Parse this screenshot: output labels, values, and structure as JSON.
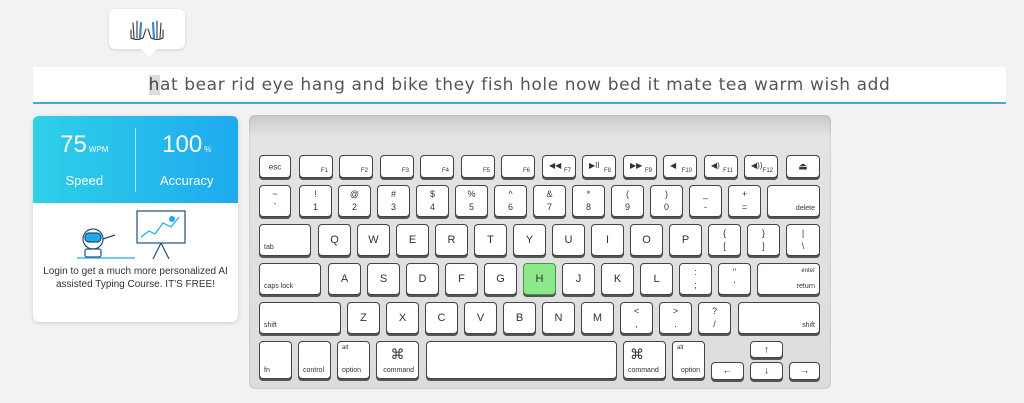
{
  "hands_icon": "hands-icon",
  "typing_text": {
    "current_char": "h",
    "remaining": "at bear rid eye hang and bike they fish hole now bed it mate tea warm wish add"
  },
  "stats": {
    "speed_value": "75",
    "speed_unit": "WPM",
    "speed_label": "Speed",
    "accuracy_value": "100",
    "accuracy_unit": "%",
    "accuracy_label": "Accuracy"
  },
  "promo": {
    "illustration_icon": "robot-presentation-icon",
    "text": "Login to get a much more personalized AI assisted Typing Course. IT'S FREE!"
  },
  "keyboard": {
    "highlighted_key": "H",
    "row_fn": [
      {
        "main": "esc"
      },
      {
        "fn": "F1"
      },
      {
        "fn": "F2"
      },
      {
        "fn": "F3"
      },
      {
        "fn": "F4"
      },
      {
        "fn": "F5"
      },
      {
        "fn": "F6"
      },
      {
        "sym": "◀◀",
        "fn": "F7"
      },
      {
        "sym": "▶II",
        "fn": "F8"
      },
      {
        "sym": "▶▶",
        "fn": "F9"
      },
      {
        "sym": "◀",
        "fn": "F10"
      },
      {
        "sym": "◀)",
        "fn": "F11"
      },
      {
        "sym": "◀))",
        "fn": "F12"
      },
      {
        "main": "⏏"
      }
    ],
    "row_num": [
      {
        "top": "~",
        "bot": "`"
      },
      {
        "top": "!",
        "bot": "1"
      },
      {
        "top": "@",
        "bot": "2"
      },
      {
        "top": "#",
        "bot": "3"
      },
      {
        "top": "$",
        "bot": "4"
      },
      {
        "top": "%",
        "bot": "5"
      },
      {
        "top": "^",
        "bot": "6"
      },
      {
        "top": "&",
        "bot": "7"
      },
      {
        "top": "*",
        "bot": "8"
      },
      {
        "top": "(",
        "bot": "9"
      },
      {
        "top": ")",
        "bot": "0"
      },
      {
        "top": "_",
        "bot": "-"
      },
      {
        "top": "+",
        "bot": "="
      },
      {
        "label": "delete"
      }
    ],
    "row_q": [
      {
        "label": "tab"
      },
      {
        "main": "Q"
      },
      {
        "main": "W"
      },
      {
        "main": "E"
      },
      {
        "main": "R"
      },
      {
        "main": "T"
      },
      {
        "main": "Y"
      },
      {
        "main": "U"
      },
      {
        "main": "I"
      },
      {
        "main": "O"
      },
      {
        "main": "P"
      },
      {
        "top": "{",
        "bot": "["
      },
      {
        "top": "}",
        "bot": "]"
      },
      {
        "top": "|",
        "bot": "\\"
      }
    ],
    "row_a": [
      {
        "label": "caps lock"
      },
      {
        "main": "A"
      },
      {
        "main": "S"
      },
      {
        "main": "D"
      },
      {
        "main": "F"
      },
      {
        "main": "G"
      },
      {
        "main": "H"
      },
      {
        "main": "J"
      },
      {
        "main": "K"
      },
      {
        "main": "L"
      },
      {
        "top": ":",
        "bot": ";"
      },
      {
        "top": "\"",
        "bot": "'"
      },
      {
        "top_right": "enter",
        "label": "return"
      }
    ],
    "row_z": [
      {
        "label": "shift"
      },
      {
        "main": "Z"
      },
      {
        "main": "X"
      },
      {
        "main": "C"
      },
      {
        "main": "V"
      },
      {
        "main": "B"
      },
      {
        "main": "N"
      },
      {
        "main": "M"
      },
      {
        "top": "<",
        "bot": ","
      },
      {
        "top": ">",
        "bot": "."
      },
      {
        "top": "?",
        "bot": "/"
      },
      {
        "label": "shift"
      }
    ],
    "row_bottom": {
      "fn": "fn",
      "control": "control",
      "option_left_top": "alt",
      "option_left": "option",
      "command_left_sym": "⌘",
      "command_left": "command",
      "command_right_sym": "⌘",
      "command_right": "command",
      "option_right_top": "alt",
      "option_right": "option",
      "arrow_left": "←",
      "arrow_up": "↑",
      "arrow_down": "↓",
      "arrow_right": "→"
    }
  }
}
